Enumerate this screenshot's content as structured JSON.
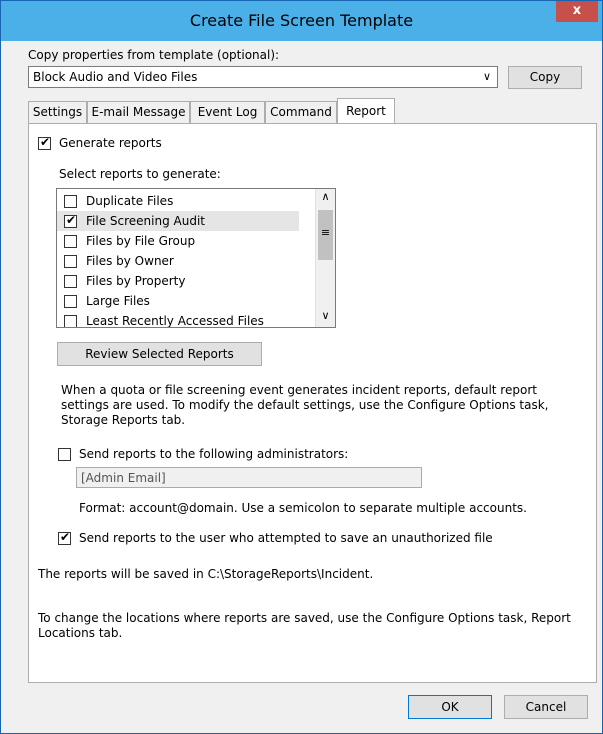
{
  "window": {
    "title": "Create File Screen Template",
    "close_glyph": "x"
  },
  "template": {
    "label": "Copy properties from template (optional):",
    "selected": "Block Audio and Video Files",
    "copy_button": "Copy"
  },
  "tabs": [
    {
      "label": "Settings"
    },
    {
      "label": "E-mail Message"
    },
    {
      "label": "Event Log"
    },
    {
      "label": "Command"
    },
    {
      "label": "Report"
    }
  ],
  "report": {
    "generate_label": "Generate reports",
    "generate_checked": true,
    "select_label": "Select reports to generate:",
    "reports": [
      {
        "label": "Duplicate Files",
        "checked": false
      },
      {
        "label": "File Screening Audit",
        "checked": true
      },
      {
        "label": "Files by File Group",
        "checked": false
      },
      {
        "label": "Files by Owner",
        "checked": false
      },
      {
        "label": "Files by Property",
        "checked": false
      },
      {
        "label": "Large Files",
        "checked": false
      },
      {
        "label": "Least Recently Accessed Files",
        "checked": false
      }
    ],
    "review_button": "Review Selected Reports",
    "info_line1": "When a quota or file screening event generates incident reports, default report",
    "info_line2": "settings are used. To modify the default settings, use the Configure Options task,",
    "info_line3": "Storage Reports tab.",
    "send_admins_label": "Send reports to the following administrators:",
    "send_admins_checked": false,
    "admin_email_value": "[Admin Email]",
    "format_text": "Format: account@domain. Use a semicolon to separate multiple accounts.",
    "send_user_label": "Send reports to the user who attempted to save an unauthorized file",
    "send_user_checked": true,
    "saved_location": "The reports will be saved in C:\\StorageReports\\Incident.",
    "change_line1": "To change the locations where reports are saved, use the Configure Options task, Report",
    "change_line2": "Locations tab."
  },
  "footer": {
    "ok": "OK",
    "cancel": "Cancel"
  },
  "colors": {
    "titlebar": "#4bb0e7",
    "close": "#c7504b",
    "frame": "#1565b3"
  }
}
